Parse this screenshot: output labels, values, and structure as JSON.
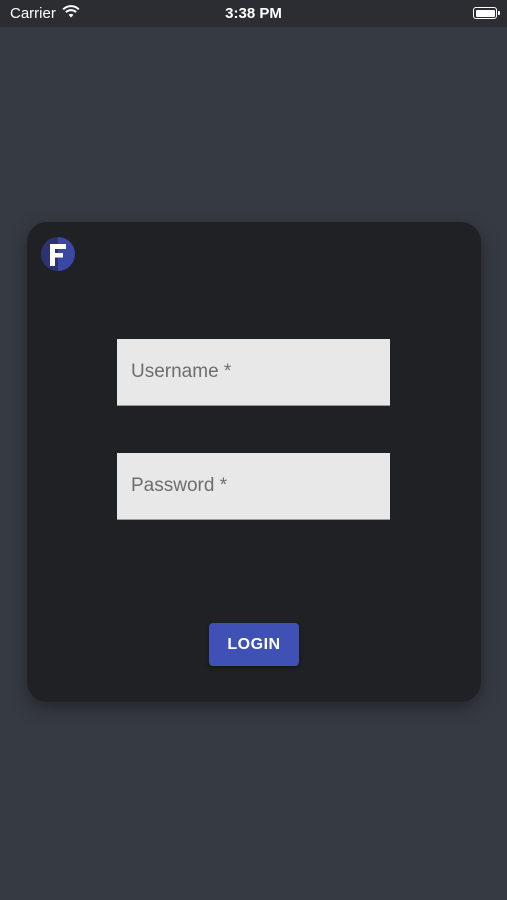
{
  "status_bar": {
    "carrier": "Carrier",
    "time": "3:38 PM",
    "wifi_icon": "wifi-icon",
    "battery_icon": "battery-full-icon",
    "battery_level": 1.0
  },
  "login_card": {
    "logo_icon": "app-logo-f",
    "username": {
      "placeholder": "Username *",
      "value": ""
    },
    "password": {
      "placeholder": "Password *",
      "value": ""
    },
    "login_label": "LOGIN"
  },
  "colors": {
    "background": "#363a42",
    "card": "#202124",
    "field": "#e8e8e8",
    "accent": "#3f51b5",
    "logo_dark": "#2c3370"
  }
}
